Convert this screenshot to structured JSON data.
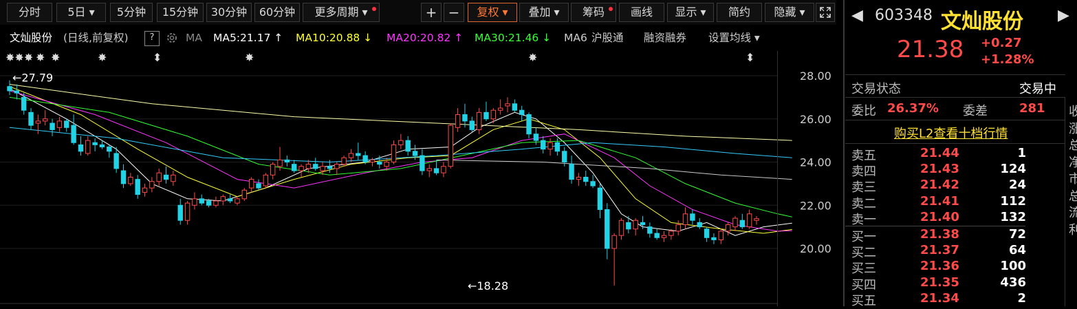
{
  "toolbar": {
    "tabs": [
      "分时",
      "5日 ▾",
      "5分钟",
      "15分钟",
      "30分钟",
      "60分钟",
      "更多周期 ▾"
    ],
    "zoom_in": "+",
    "zoom_out": "−",
    "fuquan": "复权 ▾",
    "overlay": "叠加 ▾",
    "chouma": "筹码",
    "draw": "画线",
    "display": "显示 ▾",
    "simple": "简约",
    "hide": "隐藏 ▾",
    "expand_icon": "expand-icon"
  },
  "ma_bar": {
    "name": "文灿股份",
    "mode": "(日线,前复权)",
    "help": "?",
    "ma_label": "MA",
    "ma5": "MA5:21.17 ↑",
    "ma10": "MA10:20.88 ↓",
    "ma20": "MA20:20.82 ↑",
    "ma30": "MA30:21.46 ↓",
    "ma6": "MA6",
    "hgt": "沪股通",
    "rzrq": "融资融券",
    "setting": "设置均线 ▾",
    "colors": {
      "ma5": "#ffffff",
      "ma10": "#ffff33",
      "ma20": "#ff33ff",
      "ma30": "#33ff33",
      "ma60": "#33ccff"
    }
  },
  "chart_data": {
    "type": "candlestick",
    "ylim": [
      18.0,
      28.5
    ],
    "y_ticks": [
      "28.00",
      "26.00",
      "24.00",
      "22.00",
      "20.00"
    ],
    "y_tick_values": [
      28,
      26,
      24,
      22,
      20
    ],
    "annotations": [
      {
        "text": "←27.79",
        "value": 27.79,
        "index": 0
      },
      {
        "text": "←18.28",
        "value": 18.28,
        "index": 64
      }
    ],
    "candles": [
      [
        27.5,
        27.79,
        27.1,
        27.3
      ],
      [
        27.3,
        27.6,
        26.9,
        27.2
      ],
      [
        27.0,
        27.2,
        26.2,
        26.4
      ],
      [
        26.3,
        26.5,
        25.5,
        25.7
      ],
      [
        25.8,
        26.2,
        25.3,
        25.9
      ],
      [
        25.9,
        26.4,
        25.7,
        26.0
      ],
      [
        25.8,
        26.0,
        25.2,
        25.5
      ],
      [
        25.6,
        26.1,
        25.4,
        25.9
      ],
      [
        25.9,
        26.0,
        25.4,
        25.6
      ],
      [
        25.7,
        26.2,
        24.8,
        24.9
      ],
      [
        24.8,
        25.2,
        24.3,
        24.5
      ],
      [
        24.4,
        25.2,
        24.3,
        25.0
      ],
      [
        24.9,
        25.1,
        24.5,
        24.8
      ],
      [
        24.8,
        25.0,
        24.6,
        24.7
      ],
      [
        24.7,
        24.8,
        24.2,
        24.5
      ],
      [
        24.4,
        24.7,
        23.5,
        23.7
      ],
      [
        23.6,
        23.9,
        22.8,
        23.0
      ],
      [
        23.0,
        23.5,
        22.9,
        23.3
      ],
      [
        23.2,
        23.4,
        22.3,
        22.5
      ],
      [
        22.6,
        23.0,
        22.4,
        22.8
      ],
      [
        22.8,
        23.3,
        22.6,
        23.1
      ],
      [
        23.1,
        23.7,
        22.9,
        23.5
      ],
      [
        23.4,
        23.8,
        23.0,
        23.2
      ],
      [
        23.1,
        23.6,
        22.9,
        23.4
      ],
      [
        22.0,
        22.3,
        21.1,
        21.3
      ],
      [
        21.3,
        22.2,
        21.1,
        22.1
      ],
      [
        22.0,
        22.6,
        21.8,
        22.3
      ],
      [
        22.3,
        22.5,
        22.0,
        22.1
      ],
      [
        22.2,
        22.3,
        21.9,
        22.0
      ],
      [
        22.0,
        22.4,
        21.9,
        22.2
      ],
      [
        22.2,
        22.5,
        22.0,
        22.4
      ],
      [
        22.3,
        22.5,
        22.1,
        22.2
      ],
      [
        22.1,
        22.4,
        22.0,
        22.3
      ],
      [
        22.3,
        22.8,
        22.2,
        22.7
      ],
      [
        22.8,
        23.3,
        22.6,
        23.2
      ],
      [
        23.0,
        23.2,
        22.7,
        22.8
      ],
      [
        22.9,
        23.5,
        22.8,
        23.4
      ],
      [
        23.4,
        24.0,
        23.2,
        23.9
      ],
      [
        23.8,
        24.7,
        23.6,
        24.1
      ],
      [
        24.1,
        24.3,
        23.8,
        24.0
      ],
      [
        23.9,
        24.1,
        23.5,
        23.6
      ],
      [
        23.6,
        23.9,
        23.3,
        23.8
      ],
      [
        23.7,
        24.1,
        23.5,
        23.9
      ],
      [
        23.9,
        24.2,
        23.6,
        23.7
      ],
      [
        23.6,
        24.0,
        23.4,
        23.8
      ],
      [
        23.8,
        24.1,
        23.5,
        23.7
      ],
      [
        23.7,
        24.0,
        23.4,
        23.9
      ],
      [
        23.9,
        24.3,
        23.8,
        24.2
      ],
      [
        24.2,
        24.6,
        24.0,
        24.4
      ],
      [
        24.4,
        24.9,
        24.1,
        24.3
      ],
      [
        24.3,
        24.5,
        23.9,
        24.0
      ],
      [
        24.0,
        24.2,
        23.8,
        24.1
      ],
      [
        24.0,
        24.3,
        23.7,
        23.9
      ],
      [
        23.8,
        24.2,
        23.6,
        24.0
      ],
      [
        24.0,
        25.0,
        23.9,
        24.8
      ],
      [
        24.8,
        25.3,
        24.6,
        25.0
      ],
      [
        25.0,
        25.2,
        24.3,
        24.5
      ],
      [
        24.5,
        24.8,
        24.1,
        24.3
      ],
      [
        24.3,
        24.6,
        23.4,
        23.6
      ],
      [
        23.6,
        23.9,
        23.3,
        23.7
      ],
      [
        23.7,
        24.1,
        23.4,
        23.5
      ],
      [
        23.5,
        24.0,
        23.3,
        23.8
      ],
      [
        23.8,
        25.8,
        23.7,
        25.7
      ],
      [
        25.6,
        26.5,
        25.4,
        26.2
      ],
      [
        26.2,
        26.7,
        25.6,
        25.9
      ],
      [
        25.9,
        26.1,
        25.4,
        25.5
      ],
      [
        25.5,
        26.5,
        25.3,
        26.3
      ],
      [
        26.3,
        26.8,
        25.9,
        26.0
      ],
      [
        26.0,
        26.5,
        25.8,
        26.4
      ],
      [
        26.4,
        26.9,
        26.2,
        26.5
      ],
      [
        26.6,
        27.0,
        26.3,
        26.7
      ],
      [
        26.7,
        26.9,
        26.3,
        26.4
      ],
      [
        26.4,
        26.6,
        25.9,
        26.2
      ],
      [
        26.2,
        26.3,
        25.1,
        25.3
      ],
      [
        25.3,
        25.6,
        24.8,
        25.0
      ],
      [
        25.0,
        25.2,
        24.4,
        24.6
      ],
      [
        24.6,
        25.1,
        24.3,
        24.9
      ],
      [
        24.9,
        25.1,
        24.3,
        24.5
      ],
      [
        24.5,
        24.7,
        23.8,
        24.0
      ],
      [
        23.9,
        24.3,
        23.0,
        23.2
      ],
      [
        23.2,
        23.5,
        22.9,
        23.3
      ],
      [
        23.3,
        23.6,
        22.9,
        23.1
      ],
      [
        23.1,
        23.4,
        22.8,
        22.9
      ],
      [
        22.8,
        23.0,
        21.4,
        21.8
      ],
      [
        21.8,
        22.1,
        19.5,
        20.0
      ],
      [
        20.0,
        20.7,
        18.28,
        20.6
      ],
      [
        20.6,
        21.4,
        20.4,
        21.3
      ],
      [
        21.2,
        21.5,
        20.7,
        20.9
      ],
      [
        20.9,
        21.4,
        20.6,
        21.3
      ],
      [
        21.2,
        21.5,
        20.9,
        21.1
      ],
      [
        21.0,
        21.2,
        20.5,
        20.7
      ],
      [
        20.7,
        20.9,
        20.4,
        20.5
      ],
      [
        20.5,
        20.8,
        20.3,
        20.6
      ],
      [
        20.6,
        20.9,
        20.4,
        20.8
      ],
      [
        20.8,
        21.3,
        20.6,
        21.1
      ],
      [
        21.1,
        21.9,
        20.9,
        21.6
      ],
      [
        21.6,
        21.8,
        21.1,
        21.3
      ],
      [
        21.2,
        21.4,
        20.9,
        21.0
      ],
      [
        20.9,
        21.0,
        20.3,
        20.5
      ],
      [
        20.5,
        20.7,
        20.2,
        20.4
      ],
      [
        20.4,
        20.9,
        20.2,
        20.8
      ],
      [
        20.8,
        21.2,
        20.6,
        21.1
      ],
      [
        21.0,
        21.5,
        20.8,
        21.4
      ],
      [
        21.3,
        21.6,
        20.9,
        21.0
      ],
      [
        21.0,
        21.8,
        20.9,
        21.6
      ],
      [
        21.3,
        21.5,
        21.1,
        21.38
      ]
    ],
    "ma_lines": [
      {
        "name": "MA5",
        "color": "#ffffff",
        "points": [
          [
            0,
            27.4
          ],
          [
            8,
            26.0
          ],
          [
            15,
            24.6
          ],
          [
            20,
            23.0
          ],
          [
            25,
            22.3
          ],
          [
            30,
            22.2
          ],
          [
            36,
            22.8
          ],
          [
            42,
            23.7
          ],
          [
            50,
            24.0
          ],
          [
            56,
            24.6
          ],
          [
            62,
            24.7
          ],
          [
            66,
            25.6
          ],
          [
            71,
            26.3
          ],
          [
            74,
            26.0
          ],
          [
            78,
            24.9
          ],
          [
            82,
            23.5
          ],
          [
            86,
            21.6
          ],
          [
            89,
            21.0
          ],
          [
            94,
            20.8
          ],
          [
            98,
            21.2
          ],
          [
            102,
            20.6
          ],
          [
            106,
            21.0
          ],
          [
            110,
            21.17
          ]
        ]
      },
      {
        "name": "MA10",
        "color": "#ffff33",
        "points": [
          [
            0,
            27.5
          ],
          [
            10,
            26.2
          ],
          [
            18,
            24.6
          ],
          [
            25,
            23.3
          ],
          [
            32,
            22.4
          ],
          [
            40,
            23.2
          ],
          [
            48,
            23.9
          ],
          [
            56,
            24.2
          ],
          [
            62,
            24.3
          ],
          [
            68,
            25.5
          ],
          [
            73,
            26.0
          ],
          [
            78,
            25.5
          ],
          [
            83,
            24.2
          ],
          [
            88,
            22.3
          ],
          [
            93,
            21.2
          ],
          [
            100,
            20.9
          ],
          [
            106,
            20.7
          ],
          [
            110,
            20.88
          ]
        ]
      },
      {
        "name": "MA20",
        "color": "#ff33ff",
        "points": [
          [
            0,
            27.3
          ],
          [
            12,
            26.2
          ],
          [
            22,
            24.9
          ],
          [
            32,
            23.2
          ],
          [
            40,
            22.8
          ],
          [
            50,
            23.5
          ],
          [
            58,
            24.0
          ],
          [
            65,
            24.2
          ],
          [
            72,
            25.0
          ],
          [
            78,
            25.3
          ],
          [
            85,
            24.2
          ],
          [
            90,
            22.9
          ],
          [
            96,
            21.8
          ],
          [
            102,
            21.1
          ],
          [
            108,
            20.8
          ],
          [
            110,
            20.82
          ]
        ]
      },
      {
        "name": "MA30",
        "color": "#33ff33",
        "points": [
          [
            0,
            27.0
          ],
          [
            14,
            26.3
          ],
          [
            25,
            25.2
          ],
          [
            35,
            23.9
          ],
          [
            45,
            23.4
          ],
          [
            55,
            23.7
          ],
          [
            65,
            24.4
          ],
          [
            72,
            24.9
          ],
          [
            80,
            25.0
          ],
          [
            88,
            24.2
          ],
          [
            95,
            23.0
          ],
          [
            102,
            22.1
          ],
          [
            108,
            21.6
          ],
          [
            110,
            21.46
          ]
        ]
      },
      {
        "name": "MA60",
        "color": "#33ccff",
        "points": [
          [
            0,
            25.6
          ],
          [
            15,
            25.1
          ],
          [
            30,
            24.2
          ],
          [
            45,
            24.0
          ],
          [
            60,
            24.3
          ],
          [
            72,
            24.6
          ],
          [
            82,
            24.9
          ],
          [
            92,
            24.7
          ],
          [
            102,
            24.4
          ],
          [
            110,
            24.2
          ]
        ]
      },
      {
        "name": "MA120",
        "color": "#ffffaa",
        "points": [
          [
            0,
            27.6
          ],
          [
            20,
            26.7
          ],
          [
            40,
            26.1
          ],
          [
            60,
            25.8
          ],
          [
            80,
            25.5
          ],
          [
            95,
            25.2
          ],
          [
            110,
            25.0
          ]
        ]
      },
      {
        "name": "MA250",
        "color": "#cccccc",
        "points": [
          [
            60,
            24.1
          ],
          [
            75,
            24.0
          ],
          [
            90,
            23.7
          ],
          [
            100,
            23.4
          ],
          [
            110,
            23.2
          ]
        ]
      }
    ]
  },
  "quote": {
    "code": "603348",
    "name": "文灿股份",
    "price": "21.38",
    "change": "+0.27",
    "pct": "+1.28%",
    "status_label": "交易状态",
    "status_value": "交易中",
    "wb_label": "委比",
    "wb_value": "26.37%",
    "wc_label": "委差",
    "wc_value": "281",
    "l2_link": "购买L2查看十档行情"
  },
  "order_book": {
    "asks": [
      {
        "label": "卖五",
        "price": "21.44",
        "vol": "1"
      },
      {
        "label": "卖四",
        "price": "21.43",
        "vol": "124"
      },
      {
        "label": "卖三",
        "price": "21.42",
        "vol": "24"
      },
      {
        "label": "卖二",
        "price": "21.41",
        "vol": "112"
      },
      {
        "label": "卖一",
        "price": "21.40",
        "vol": "132"
      }
    ],
    "bids": [
      {
        "label": "买一",
        "price": "21.38",
        "vol": "72"
      },
      {
        "label": "买二",
        "price": "21.37",
        "vol": "64"
      },
      {
        "label": "买三",
        "price": "21.36",
        "vol": "100"
      },
      {
        "label": "买四",
        "price": "21.35",
        "vol": "436"
      },
      {
        "label": "买五",
        "price": "21.34",
        "vol": "2"
      }
    ]
  },
  "edge_glyphs": [
    "收",
    "涨",
    "总",
    "净",
    "市",
    "总",
    "流",
    "利"
  ],
  "colors": {
    "up": "#ff4a4a",
    "down": "#22d3e6",
    "accent": "#ff7733"
  }
}
